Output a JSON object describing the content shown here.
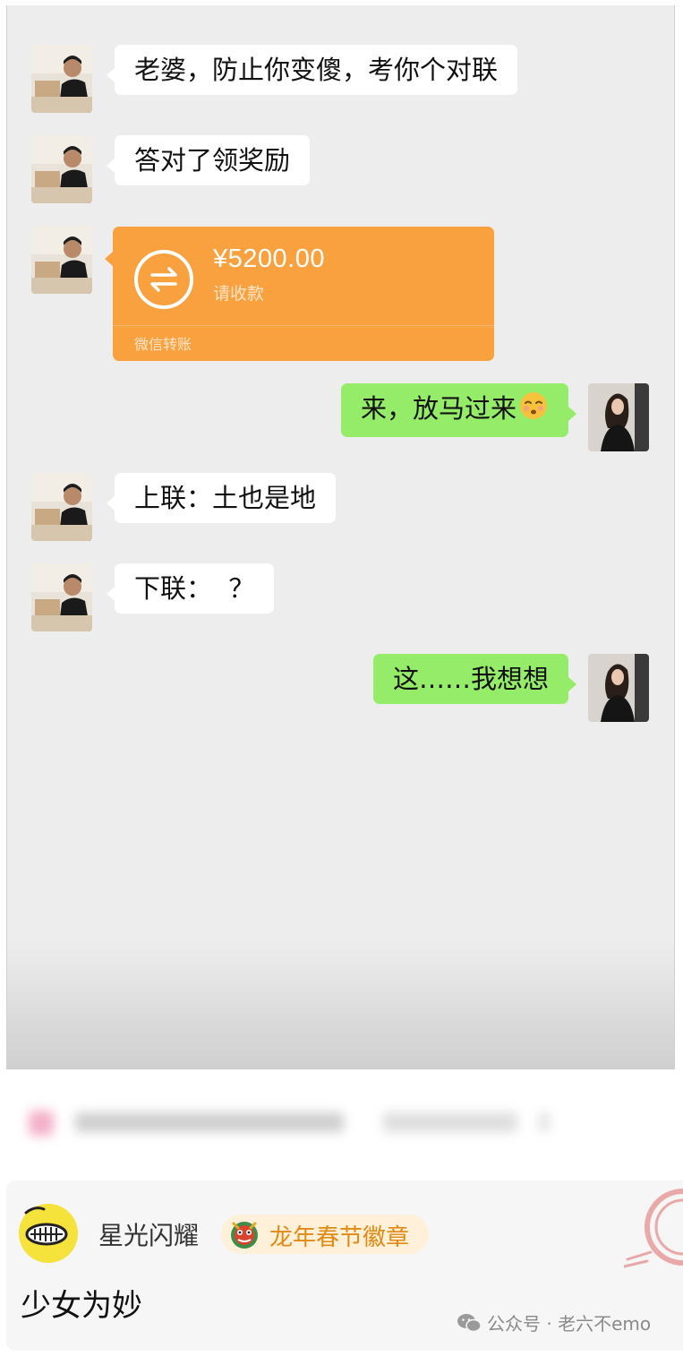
{
  "chat": {
    "messages": [
      {
        "side": "left",
        "text": "老婆，防止你变傻，考你个对联"
      },
      {
        "side": "left",
        "text": "答对了领奖励"
      },
      {
        "side": "left",
        "type": "transfer",
        "amount": "¥5200.00",
        "status": "请收款",
        "caption": "微信转账"
      },
      {
        "side": "right",
        "text": "来，放马过来",
        "emoji": "kissing-face-emoji"
      },
      {
        "side": "left",
        "text": "上联：土也是地"
      },
      {
        "side": "left",
        "text": "下联：  ？"
      },
      {
        "side": "right",
        "text": "这……我想想"
      }
    ]
  },
  "comment": {
    "username": "星光闪耀",
    "badge": "龙年春节徽章",
    "text": "少女为妙"
  },
  "watermark": {
    "text": "公众号 · 老六不emo",
    "icon": "wechat-icon"
  },
  "colors": {
    "chat_bg": "#ededed",
    "green_bubble": "#95ec69",
    "transfer_orange": "#f9a13f",
    "badge_text": "#e08a13"
  }
}
